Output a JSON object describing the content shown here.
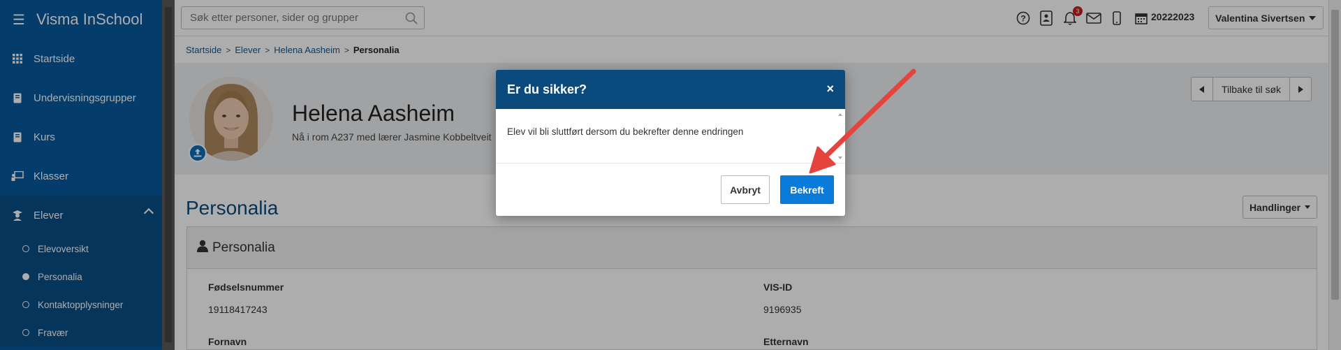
{
  "app": {
    "name": "Visma InSchool"
  },
  "sidebar": {
    "items": [
      {
        "label": "Startside",
        "icon": "grid-icon"
      },
      {
        "label": "Undervisningsgrupper",
        "icon": "book-icon"
      },
      {
        "label": "Kurs",
        "icon": "book-icon"
      },
      {
        "label": "Klasser",
        "icon": "presentation-icon"
      }
    ],
    "elever": {
      "label": "Elever",
      "icon": "student-icon",
      "subitems": [
        {
          "label": "Elevoversikt",
          "active": false
        },
        {
          "label": "Personalia",
          "active": true
        },
        {
          "label": "Kontaktopplysninger",
          "active": false
        },
        {
          "label": "Fravær",
          "active": false
        }
      ]
    }
  },
  "topbar": {
    "search_placeholder": "Søk etter personer, sider og grupper",
    "notification_count": "3",
    "school_year": "20222023",
    "user_name": "Valentina Sivertsen"
  },
  "breadcrumb": [
    "Startside",
    "Elever",
    "Helena Aasheim",
    "Personalia"
  ],
  "student": {
    "name": "Helena Aasheim",
    "room_info": "Nå i rom A237 med lærer Jasmine Kobbeltveit"
  },
  "nav": {
    "back_label": "Tilbake til søk"
  },
  "section": {
    "title": "Personalia",
    "actions_label": "Handlinger",
    "panel_title": "Personalia"
  },
  "fields": {
    "fodselsnummer_label": "Fødselsnummer",
    "fodselsnummer_value": "19118417243",
    "visid_label": "VIS-ID",
    "visid_value": "9196935",
    "fornavn_label": "Fornavn",
    "etternavn_label": "Etternavn"
  },
  "modal": {
    "title": "Er du sikker?",
    "close_glyph": "×",
    "message": "Elev vil bli sluttført dersom du bekrefter denne endringen",
    "cancel_label": "Avbryt",
    "confirm_label": "Bekreft"
  },
  "colors": {
    "sidebar": "#075a9e",
    "modal_header": "#0b4a7d",
    "confirm_button": "#0a7bd8",
    "annotation_arrow": "#e5433c"
  }
}
